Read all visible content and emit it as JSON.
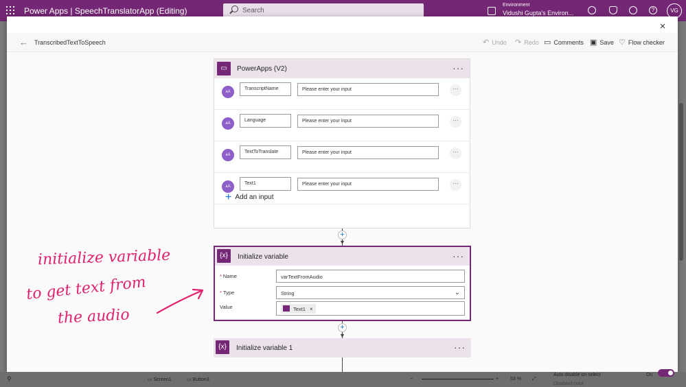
{
  "suite": {
    "app_title": "Power Apps  |  SpeechTranslatorApp (Editing)",
    "search_placeholder": "Search",
    "env_label": "Environment",
    "env_value": "Vidushi Gupta's Environ...",
    "avatar_initials": "VG"
  },
  "flow": {
    "name": "TranscribedTextToSpeech",
    "toolbar": {
      "undo": "Undo",
      "redo": "Redo",
      "comments": "Comments",
      "save": "Save",
      "flow_checker": "Flow checker"
    },
    "close": "×"
  },
  "trigger": {
    "title": "PowerApps (V2)",
    "more": "···",
    "params": [
      {
        "name": "TranscriptName",
        "placeholder": "Please enter your input",
        "icon": "text-param-icon"
      },
      {
        "name": "Language",
        "placeholder": "Please enter your input",
        "icon": "text-param-icon"
      },
      {
        "name": "TextToTranslate",
        "placeholder": "Please enter your input",
        "icon": "text-param-icon"
      },
      {
        "name": "Text1",
        "placeholder": "Please enter your input",
        "icon": "text-param-icon"
      }
    ],
    "param_icon_text": "ᴀA",
    "param_more": "···",
    "add_input": "Add an input"
  },
  "init_var": {
    "title": "Initialize variable",
    "logo": "{x}",
    "more": "···",
    "name_label": "Name",
    "name_value": "varTextFromAudio",
    "type_label": "Type",
    "type_value": "String",
    "value_label": "Value",
    "token_text": "Text1",
    "token_remove": "×"
  },
  "init_var_1": {
    "title": "Initialize variable 1",
    "logo": "{x}",
    "more": "···"
  },
  "annotation": {
    "line1": "initialize variable",
    "line2": "to get text from",
    "line3": "the audio"
  },
  "background": {
    "screen1": "Screen1",
    "button3": "Button3",
    "zoom": "53  %",
    "auto_disable": "Auto disable on select",
    "on": "On",
    "disabled_color": "Disabled color"
  },
  "colors": {
    "brand": "#742774",
    "accent_blue": "#0e6fd6",
    "annotation": "#e0226e"
  }
}
